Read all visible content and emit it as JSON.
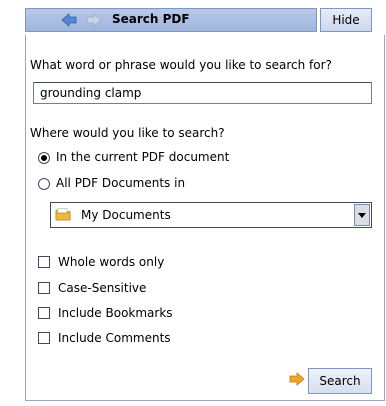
{
  "header": {
    "title": "Search PDF",
    "hide_label": "Hide",
    "back_icon": "back-arrow-icon",
    "forward_icon": "forward-arrow-icon"
  },
  "form": {
    "question": "What word or phrase would you like to search for?",
    "search_value": "grounding clamp",
    "where_label": "Where would you like to search?",
    "options": {
      "current_pdf": "In the current PDF document",
      "all_pdfs": "All PDF Documents in",
      "selected": "current_pdf"
    },
    "location": {
      "selected": "My Documents",
      "icon": "folder-icon"
    },
    "checkboxes": {
      "whole_words": "Whole words only",
      "case_sensitive": "Case-Sensitive",
      "bookmarks": "Include Bookmarks",
      "comments": "Include Comments"
    },
    "search_button": "Search"
  },
  "colors": {
    "titlebar_top": "#b9c9e8",
    "titlebar_bottom": "#9fb5dd",
    "arrow_orange": "#f0a52a",
    "border_blue": "#7f97c6"
  }
}
